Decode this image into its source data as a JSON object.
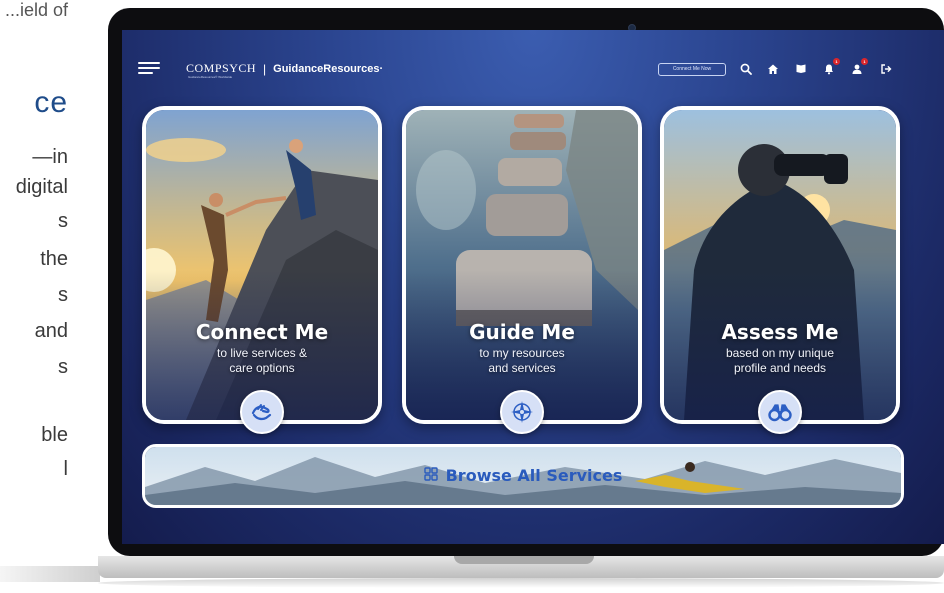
{
  "side_page": {
    "top_fragment": "...ield of",
    "heading_fragment": "ce",
    "body_fragments": [
      "—in",
      "digital",
      "s",
      "the",
      "s",
      "and",
      "s",
      "",
      "ble",
      "l"
    ]
  },
  "header": {
    "brand_name": "ComPsych",
    "brand_tagline": "GuidanceResources® Worldwide",
    "separator": "|",
    "product_name": "GuidanceResources·",
    "connect_now_label": "Connect Me Now",
    "icons": [
      "search-icon",
      "home-icon",
      "flag-icon",
      "bell-icon",
      "profile-icon",
      "logout-icon"
    ],
    "bell_badge": "1",
    "profile_badge": "1"
  },
  "cards": [
    {
      "title": "Connect Me",
      "subtitle_line1": "to live services &",
      "subtitle_line2": "care options",
      "icon": "helping-hand-icon"
    },
    {
      "title": "Guide Me",
      "subtitle_line1": "to my resources",
      "subtitle_line2": "and services",
      "icon": "compass-icon"
    },
    {
      "title": "Assess Me",
      "subtitle_line1": "based on my unique",
      "subtitle_line2": "profile and needs",
      "icon": "binoculars-icon"
    }
  ],
  "browse": {
    "label": "Browse All Services",
    "icon": "grid-icon"
  },
  "colors": {
    "screen_top": "#3b5db0",
    "screen_bottom": "#141c4d",
    "browse_text": "#2a5bbd",
    "icon_button_bg": "#d6e0f6",
    "badge": "#d9262c",
    "side_heading": "#1f4c8a"
  }
}
